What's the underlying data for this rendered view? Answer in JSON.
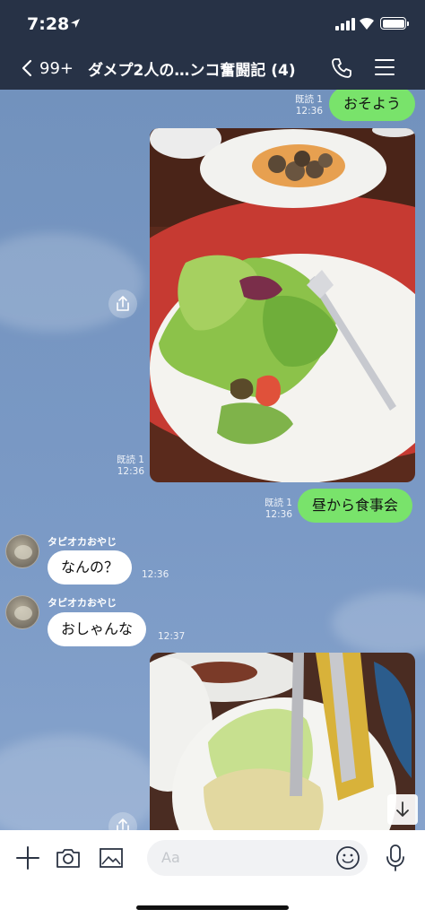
{
  "status_bar": {
    "time": "7:28"
  },
  "header": {
    "back_count": "99+",
    "title": "ダメプ2人の…ンコ奮闘記 (4)"
  },
  "icons": {
    "back": "chevron-left-icon",
    "phone": "phone-icon",
    "menu": "hamburger-menu-icon",
    "share": "share-icon",
    "scroll_down": "arrow-down-icon",
    "add": "plus-icon",
    "camera": "camera-icon",
    "image": "image-icon",
    "emoji": "smiley-icon",
    "mic": "microphone-icon"
  },
  "colors": {
    "header_bg": "#273246",
    "chat_bg": "#7b9ac6",
    "outgoing_bubble": "#79e36b",
    "incoming_bubble": "#ffffff"
  },
  "messages": [
    {
      "type": "text",
      "direction": "out",
      "text": "おそよう",
      "read": "既読 1",
      "time": "12:36"
    },
    {
      "type": "photo",
      "direction": "out",
      "read": "既読 1",
      "time": "12:36"
    },
    {
      "type": "text",
      "direction": "out",
      "text": "昼から食事会",
      "read": "既読 1",
      "time": "12:36"
    },
    {
      "type": "text",
      "direction": "in",
      "sender": "タピオカおやじ",
      "text": "なんの？",
      "time": "12:36"
    },
    {
      "type": "text",
      "direction": "in",
      "sender": "タピオカおやじ",
      "text": "おしゃんな",
      "time": "12:37"
    },
    {
      "type": "photo",
      "direction": "out"
    }
  ],
  "input": {
    "placeholder": "Aa"
  }
}
